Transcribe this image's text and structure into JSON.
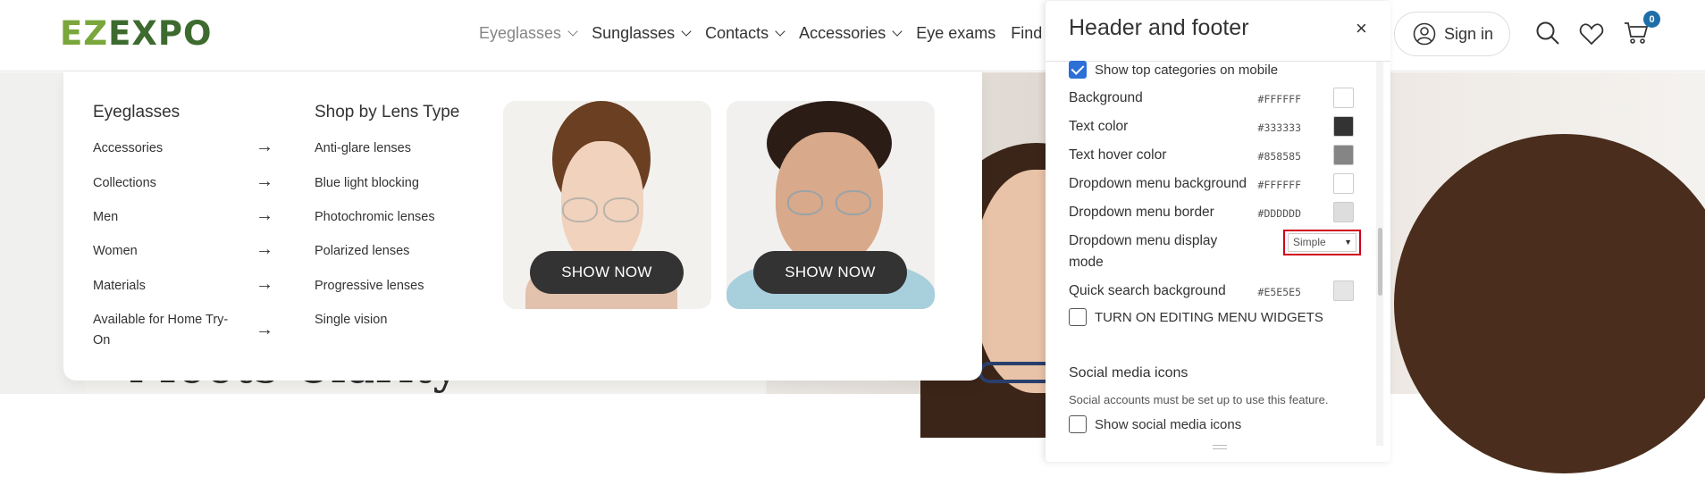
{
  "brand": {
    "logo_text_a": "EZ",
    "logo_text_b": "EXPO"
  },
  "nav": {
    "items": [
      {
        "label": "Eyeglasses",
        "has_dropdown": true,
        "active": true
      },
      {
        "label": "Sunglasses",
        "has_dropdown": true
      },
      {
        "label": "Contacts",
        "has_dropdown": true
      },
      {
        "label": "Accessories",
        "has_dropdown": true
      },
      {
        "label": "Eye exams",
        "has_dropdown": false
      },
      {
        "label": "Find a store",
        "has_dropdown": false
      }
    ]
  },
  "header_actions": {
    "sign_in_label": "Sign in",
    "cart_count": "0",
    "icons": [
      "user-icon",
      "search-icon",
      "heart-icon",
      "cart-icon"
    ]
  },
  "hero": {
    "heading_fragment": "Meets Clarity"
  },
  "mega_menu": {
    "col1_title": "Eyeglasses",
    "col1_links": [
      "Accessories",
      "Collections",
      "Men",
      "Women",
      "Materials",
      "Available for Home Try-",
      "On"
    ],
    "col2_title": "Shop by Lens Type",
    "col2_links": [
      "Anti-glare lenses",
      "Blue light blocking",
      "Photochromic lenses",
      "Polarized lenses",
      "Progressive lenses",
      "Single vision"
    ],
    "promo_button_1": "SHOW NOW",
    "promo_button_2": "SHOW NOW"
  },
  "panel": {
    "title": "Header and footer",
    "close_icon": "×",
    "show_top_categories_label": "Show top categories on mobile",
    "show_top_categories_checked": true,
    "settings": [
      {
        "label": "Background",
        "value": "#FFFFFF",
        "color": "#FFFFFF"
      },
      {
        "label": "Text color",
        "value": "#333333",
        "color": "#333333"
      },
      {
        "label": "Text hover color",
        "value": "#858585",
        "color": "#858585"
      },
      {
        "label": "Dropdown menu background",
        "value": "#FFFFFF",
        "color": "#FFFFFF"
      },
      {
        "label": "Dropdown menu border",
        "value": "#DDDDDD",
        "color": "#DDDDDD"
      }
    ],
    "display_mode_label_1": "Dropdown menu display",
    "display_mode_label_2": "mode",
    "display_mode_value": "Simple",
    "quick_search_label": "Quick search background",
    "quick_search_value": "#E5E5E5",
    "quick_search_color": "#E5E5E5",
    "editing_widgets_label": "TURN ON EDITING MENU WIDGETS",
    "editing_widgets_checked": false,
    "social_title": "Social media icons",
    "social_help": "Social accounts must be set up to use this feature.",
    "show_social_label": "Show social media icons",
    "show_social_checked": false
  },
  "colors": {
    "accent": "#2C6FD6",
    "highlight_border": "#D0021B",
    "button_dark": "#333333",
    "logo_green": "#7AA63C"
  }
}
